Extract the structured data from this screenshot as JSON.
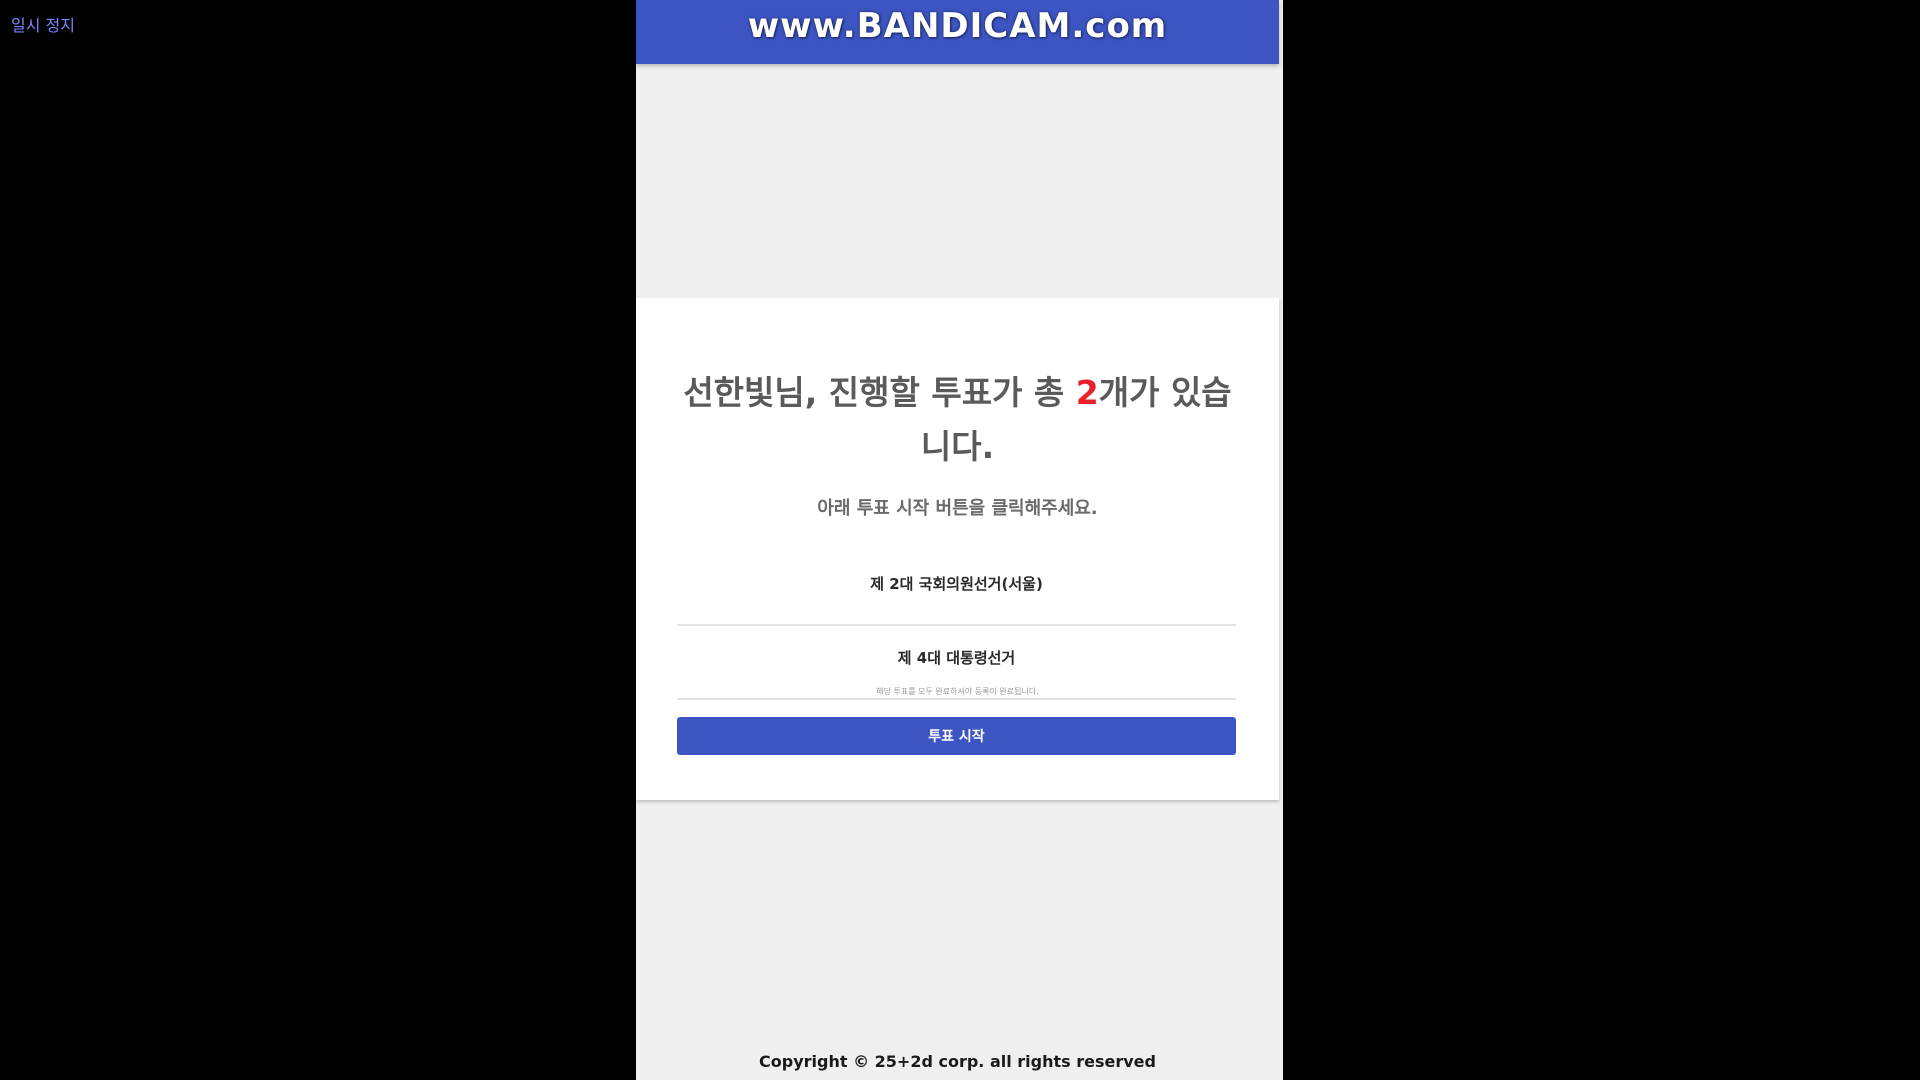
{
  "player": {
    "pause_label": "일시 정지"
  },
  "recorder": {
    "watermark": "www.BANDICAM.com"
  },
  "vote": {
    "headline_prefix": "선한빛님, 진행할 투표가 총 ",
    "headline_count": "2",
    "headline_suffix": "개가 있습니다.",
    "subtitle": "아래 투표 시작 버튼을 클릭해주세요.",
    "items": [
      {
        "label": "제 2대 국회의원선거(서울)"
      },
      {
        "label": "제 4대 대통령선거"
      }
    ],
    "note": "해당 투표를 모두 완료하셔야 등록이 완료됩니다.",
    "start_button": "투표 시작"
  },
  "footer": {
    "copyright": "Copyright © 25+2d corp. all rights reserved"
  },
  "colors": {
    "brand_blue": "#3d55c2",
    "count_red": "#e8202a",
    "page_gray": "#efefef"
  }
}
